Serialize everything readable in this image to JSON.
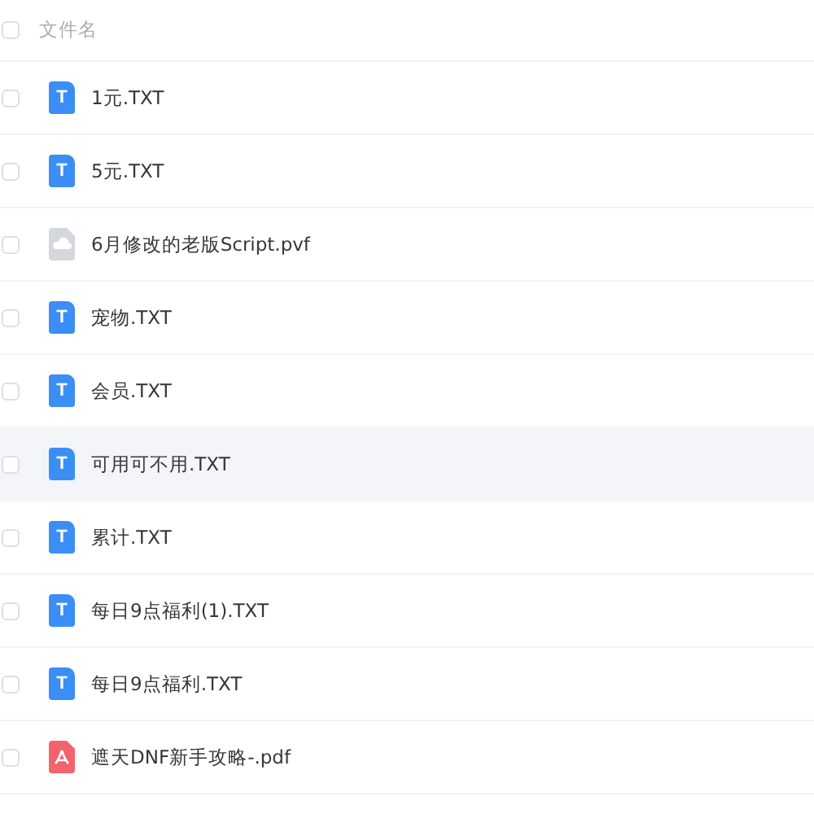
{
  "header": {
    "label": "文件名",
    "checked": false
  },
  "files": [
    {
      "name": "1元.TXT",
      "kind": "txt",
      "letter": "T",
      "checked": false,
      "highlighted": false
    },
    {
      "name": "5元.TXT",
      "kind": "txt",
      "letter": "T",
      "checked": false,
      "highlighted": false
    },
    {
      "name": "6月修改的老版Script.pvf",
      "kind": "unknown",
      "checked": false,
      "highlighted": false
    },
    {
      "name": "宠物.TXT",
      "kind": "txt",
      "letter": "T",
      "checked": false,
      "highlighted": false
    },
    {
      "name": "会员.TXT",
      "kind": "txt",
      "letter": "T",
      "checked": false,
      "highlighted": false
    },
    {
      "name": "可用可不用.TXT",
      "kind": "txt",
      "letter": "T",
      "checked": false,
      "highlighted": true
    },
    {
      "name": "累计.TXT",
      "kind": "txt",
      "letter": "T",
      "checked": false,
      "highlighted": false
    },
    {
      "name": "每日9点福利(1).TXT",
      "kind": "txt",
      "letter": "T",
      "checked": false,
      "highlighted": false
    },
    {
      "name": "每日9点福利.TXT",
      "kind": "txt",
      "letter": "T",
      "checked": false,
      "highlighted": false
    },
    {
      "name": "遮天DNF新手攻略-.pdf",
      "kind": "pdf",
      "checked": false,
      "highlighted": false
    }
  ]
}
